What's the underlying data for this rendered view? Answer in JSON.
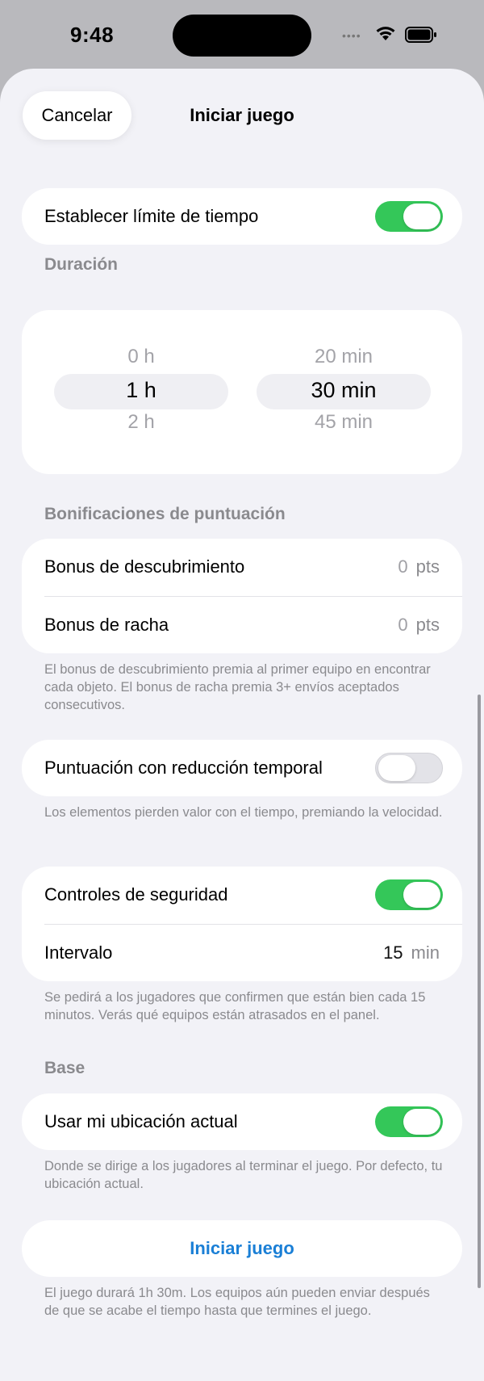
{
  "status_bar": {
    "time": "9:48",
    "signal": "••••"
  },
  "nav": {
    "cancel_label": "Cancelar",
    "title": "Iniciar juego"
  },
  "time_limit": {
    "label": "Establecer límite de tiempo",
    "enabled": true
  },
  "duration": {
    "header": "Duración",
    "hours": {
      "prev": "0 h",
      "selected": "1 h",
      "next": "2 h"
    },
    "minutes": {
      "prev": "20 min",
      "selected": "30 min",
      "next": "45 min"
    }
  },
  "bonuses": {
    "header": "Bonificaciones de puntuación",
    "discovery": {
      "label": "Bonus de descubrimiento",
      "value": "0",
      "unit": "pts"
    },
    "streak": {
      "label": "Bonus de racha",
      "value": "0",
      "unit": "pts"
    },
    "footnote": "El bonus de descubrimiento premia al primer equipo en encontrar cada objeto. El bonus de racha premia 3+ envíos aceptados consecutivos."
  },
  "decay": {
    "label": "Puntuación con reducción temporal",
    "enabled": false,
    "footnote": "Los elementos pierden valor con el tiempo, premiando la velocidad."
  },
  "safety": {
    "label": "Controles de seguridad",
    "enabled": true,
    "interval_label": "Intervalo",
    "interval_value": "15",
    "interval_unit": "min",
    "footnote": "Se pedirá a los jugadores que confirmen que están bien cada 15 minutos. Verás qué equipos están atrasados en el panel."
  },
  "base": {
    "header": "Base",
    "label": "Usar mi ubicación actual",
    "enabled": true,
    "footnote": "Donde se dirige a los jugadores al terminar el juego. Por defecto, tu ubicación actual."
  },
  "start": {
    "label": "Iniciar juego",
    "footnote": "El juego durará 1h 30m. Los equipos aún pueden enviar después de que se acabe el tiempo hasta que termines el juego."
  },
  "colors": {
    "toggle_on": "#34c759",
    "accent": "#1a7fd6",
    "background": "#f2f2f7"
  }
}
